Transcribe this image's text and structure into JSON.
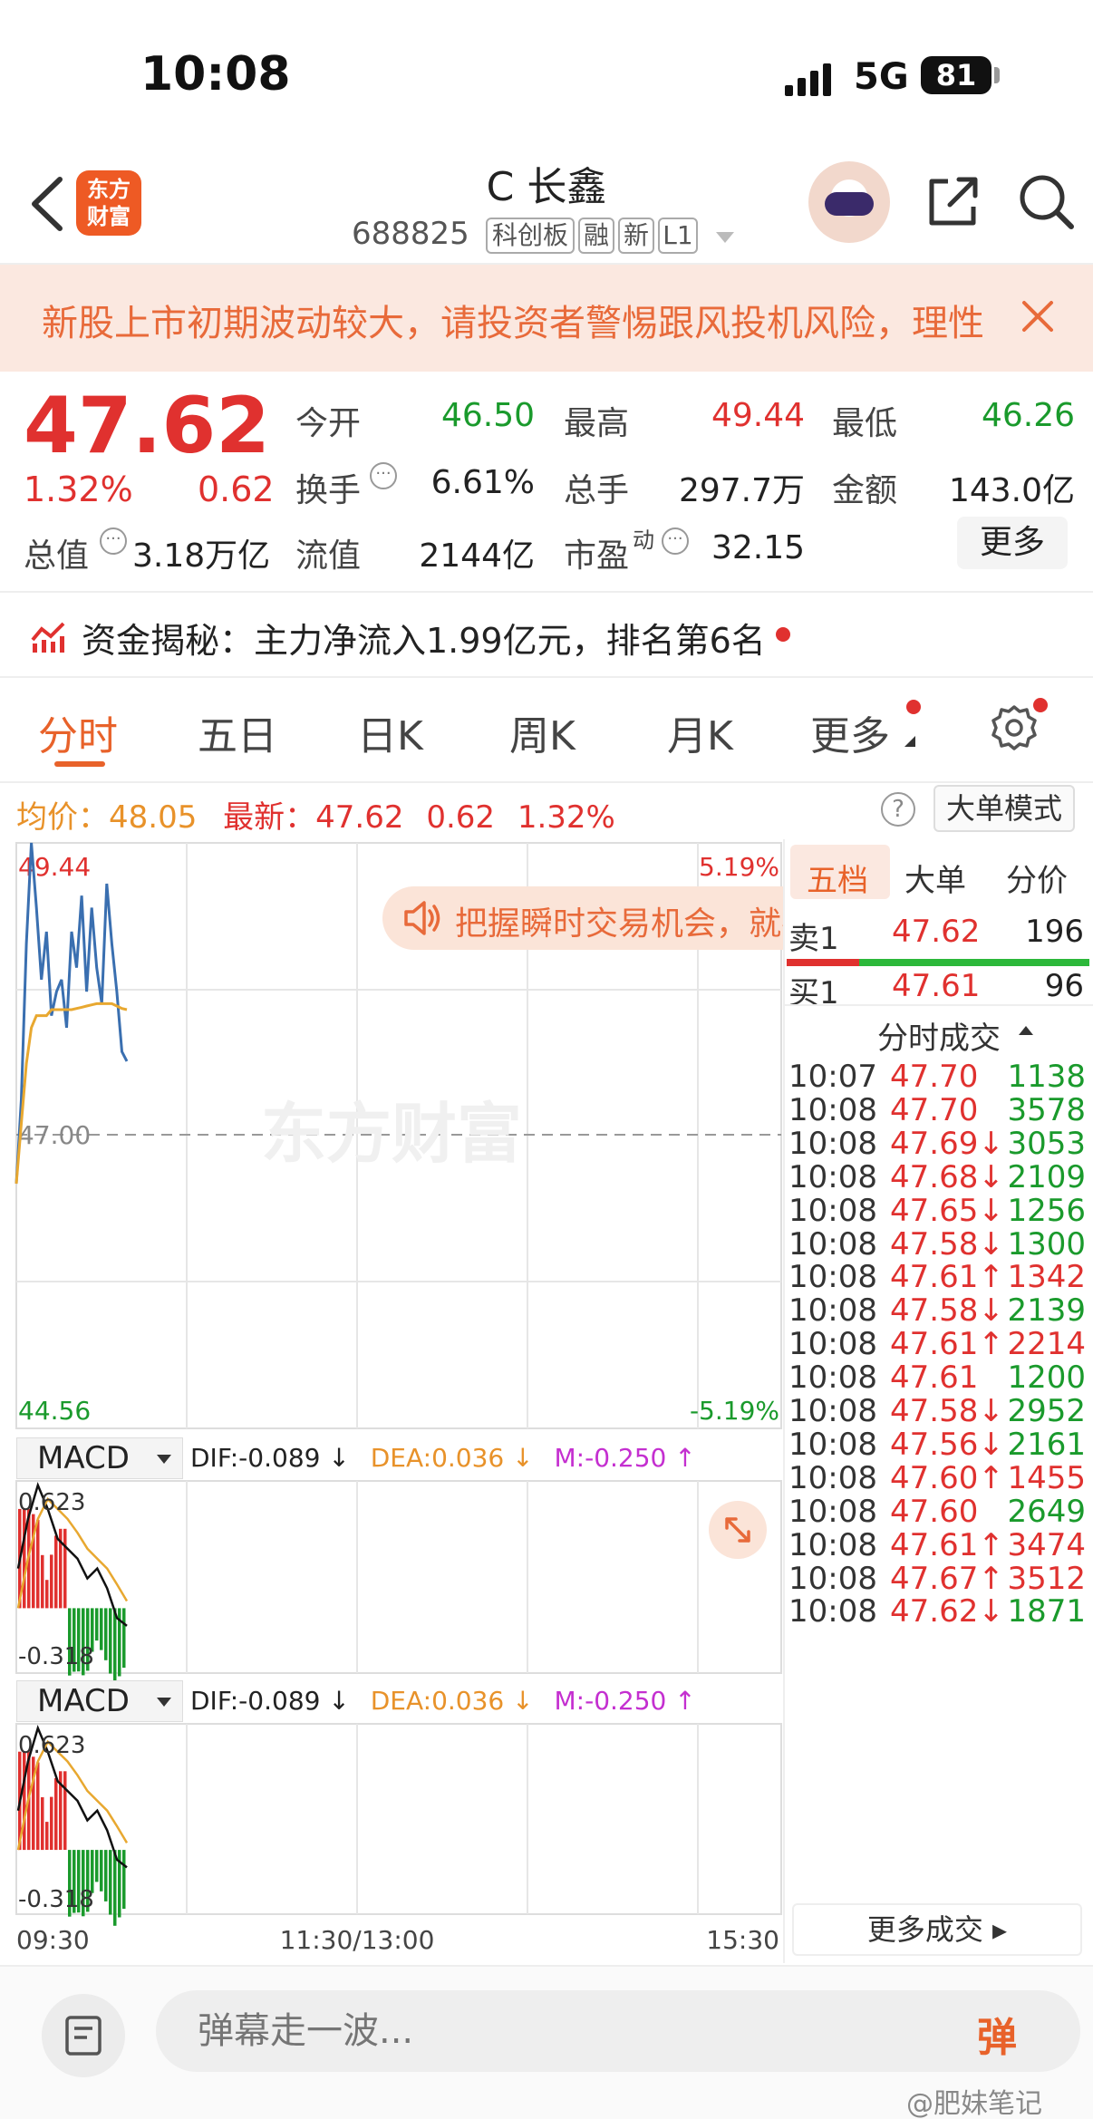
{
  "status_bar": {
    "time": "10:08",
    "network": "5G",
    "battery": "81"
  },
  "header": {
    "logo_text": [
      "东方",
      "财富"
    ],
    "stock_name": "C 长鑫",
    "stock_code": "688825",
    "tags": [
      "科创板",
      "融",
      "新",
      "L1"
    ]
  },
  "banner": {
    "text": "新股上市初期波动较大，请投资者警惕跟风投机风险，理性"
  },
  "quote": {
    "price": "47.62",
    "change_pct": "1.32%",
    "change": "0.62",
    "open_label": "今开",
    "open": "46.50",
    "high_label": "最高",
    "high": "49.44",
    "low_label": "最低",
    "low": "46.26",
    "turnover_label": "换手",
    "turnover": "6.61%",
    "volume_label": "总手",
    "volume": "297.7万",
    "amount_label": "金额",
    "amount": "143.0亿",
    "mktcap_label": "总值",
    "mktcap": "3.18万亿",
    "float_label": "流值",
    "float_cap": "2144亿",
    "pe_label": "市盈",
    "pe_sup": "动",
    "pe": "32.15",
    "more_label": "更多"
  },
  "fund_flow": {
    "text": "资金揭秘：主力净流入1.99亿元，排名第6名"
  },
  "period_tabs": [
    "分时",
    "五日",
    "日K",
    "周K",
    "月K",
    "更多"
  ],
  "avg_row": {
    "avg_label": "均价：",
    "avg": "48.05",
    "latest_label": "最新：",
    "latest": "47.62",
    "latest_change": "0.62",
    "latest_pct": "1.32%",
    "help": "?",
    "big_order_mode": "大单模式"
  },
  "chart": {
    "y_max_label": "49.44",
    "y_min_label": "44.56",
    "pct_max_label": "5.19%",
    "pct_min_label": "-5.19%",
    "prev_close_label": "47.00",
    "x_labels": [
      "09:30",
      "11:30/13:00",
      "15:30"
    ],
    "popup_text": "把握瞬时交易机会，就在",
    "watermark": "东方财富",
    "colors": {
      "price_line": "#3a6fb0",
      "avg_line": "#e8a830",
      "up": "#e0312f",
      "down": "#1a9a2c"
    }
  },
  "chart_data": [
    {
      "type": "line",
      "series": [
        {
          "values": [
            46.6,
            47.3,
            48.6,
            49.44,
            48.9,
            48.3,
            48.7,
            48.0,
            48.2,
            48.3,
            47.9,
            48.7,
            48.4,
            49.0,
            48.2,
            48.9,
            48.4,
            48.1,
            49.1,
            48.6,
            48.2,
            47.7,
            47.62
          ]
        },
        {
          "values": [
            46.6,
            47.1,
            47.6,
            47.9,
            48.0,
            48.0,
            48.0,
            48.05,
            48.05,
            48.05,
            48.05,
            48.05,
            48.06,
            48.07,
            48.08,
            48.09,
            48.1,
            48.1,
            48.1,
            48.1,
            48.08,
            48.06,
            48.05
          ]
        }
      ],
      "ylim": [
        44.56,
        49.44
      ]
    },
    {
      "type": "bar",
      "series": [
        {
          "name": "DIF",
          "values": [
            0.2,
            0.45,
            0.62,
            0.5,
            0.35,
            0.3,
            0.25,
            0.15,
            0.2,
            0.1,
            -0.05,
            -0.089
          ]
        },
        {
          "name": "DEA",
          "values": [
            0.0,
            0.25,
            0.45,
            0.55,
            0.5,
            0.45,
            0.38,
            0.3,
            0.25,
            0.2,
            0.12,
            0.036
          ]
        }
      ],
      "ylim": [
        -0.318,
        0.623
      ]
    }
  ],
  "macd": [
    {
      "label": "MACD",
      "dif": "DIF:-0.089 ↓",
      "dea": "DEA:0.036 ↓",
      "m": "M:-0.250 ↑",
      "top": "0.623",
      "bottom": "-0.318"
    },
    {
      "label": "MACD",
      "dif": "DIF:-0.089 ↓",
      "dea": "DEA:0.036 ↓",
      "m": "M:-0.250 ↑",
      "top": "0.623",
      "bottom": "-0.318"
    }
  ],
  "right_panel": {
    "tabs": [
      "五档",
      "大单",
      "分价"
    ],
    "sell1": {
      "label": "卖1",
      "price": "47.62",
      "vol": "196"
    },
    "buy1": {
      "label": "买1",
      "price": "47.61",
      "vol": "96"
    },
    "trades_title": "分时成交",
    "trades": [
      {
        "time": "10:07",
        "price": "47.70",
        "vol": "1138",
        "dir": ""
      },
      {
        "time": "10:08",
        "price": "47.70",
        "vol": "3578",
        "dir": ""
      },
      {
        "time": "10:08",
        "price": "47.69↓",
        "vol": "3053",
        "dir": "down"
      },
      {
        "time": "10:08",
        "price": "47.68↓",
        "vol": "2109",
        "dir": "down"
      },
      {
        "time": "10:08",
        "price": "47.65↓",
        "vol": "1256",
        "dir": "down"
      },
      {
        "time": "10:08",
        "price": "47.58↓",
        "vol": "1300",
        "dir": "down"
      },
      {
        "time": "10:08",
        "price": "47.61↑",
        "vol": "1342",
        "dir": "up"
      },
      {
        "time": "10:08",
        "price": "47.58↓",
        "vol": "2139",
        "dir": "down"
      },
      {
        "time": "10:08",
        "price": "47.61↑",
        "vol": "2214",
        "dir": "up"
      },
      {
        "time": "10:08",
        "price": "47.61",
        "vol": "1200",
        "dir": "down"
      },
      {
        "time": "10:08",
        "price": "47.58↓",
        "vol": "2952",
        "dir": "down"
      },
      {
        "time": "10:08",
        "price": "47.56↓",
        "vol": "2161",
        "dir": "down"
      },
      {
        "time": "10:08",
        "price": "47.60↑",
        "vol": "1455",
        "dir": "up"
      },
      {
        "time": "10:08",
        "price": "47.60",
        "vol": "2649",
        "dir": "down"
      },
      {
        "time": "10:08",
        "price": "47.61↑",
        "vol": "3474",
        "dir": "up"
      },
      {
        "time": "10:08",
        "price": "47.67↑",
        "vol": "3512",
        "dir": "up"
      },
      {
        "time": "10:08",
        "price": "47.62↓",
        "vol": "1871",
        "dir": "down"
      }
    ],
    "more_trades": "更多成交 ▸"
  },
  "bottom": {
    "danmu_placeholder": "弹幕走一波...",
    "danmu_btn": "弹",
    "watermark": "@肥妹笔记"
  }
}
